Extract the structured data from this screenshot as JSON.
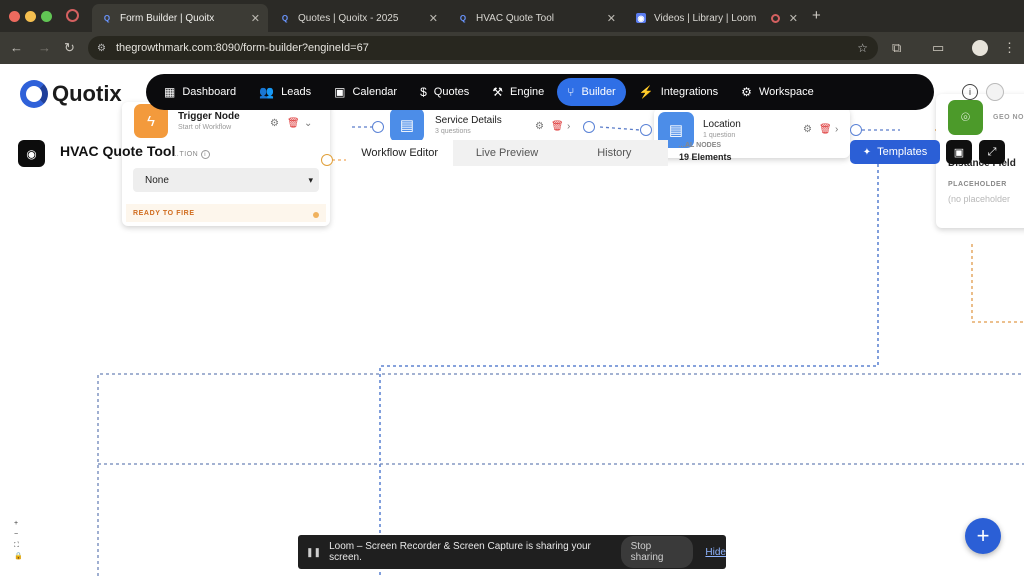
{
  "browser": {
    "tabs": [
      {
        "title": "Form Builder | Quoitx",
        "active": true,
        "favicon": "quotix-icon"
      },
      {
        "title": "Quotes | Quoitx - 2025",
        "active": false,
        "favicon": "quotix-icon"
      },
      {
        "title": "HVAC Quote Tool",
        "active": false,
        "favicon": "quotix-icon"
      },
      {
        "title": "Videos | Library | Loom",
        "active": false,
        "favicon": "loom-icon"
      }
    ],
    "url": "thegrowthmark.com:8090/form-builder?engineId=67"
  },
  "app": {
    "logo_text": "Quotix",
    "nav": [
      {
        "label": "Dashboard",
        "icon": "grid-icon",
        "active": false
      },
      {
        "label": "Leads",
        "icon": "users-icon",
        "active": false
      },
      {
        "label": "Calendar",
        "icon": "calendar-icon",
        "active": false
      },
      {
        "label": "Quotes",
        "icon": "dollar-icon",
        "active": false
      },
      {
        "label": "Engine",
        "icon": "engine-icon",
        "active": false
      },
      {
        "label": "Builder",
        "icon": "builder-icon",
        "active": true
      },
      {
        "label": "Integrations",
        "icon": "plug-icon",
        "active": false
      },
      {
        "label": "Workspace",
        "icon": "gear-icon",
        "active": false
      }
    ],
    "tool_title": "HVAC Quote Tool",
    "editor_tabs": [
      {
        "label": "Workflow Editor",
        "active": true
      },
      {
        "label": "Live Preview",
        "active": false
      },
      {
        "label": "History",
        "active": false
      }
    ],
    "templates_label": "Templates",
    "nodes": {
      "trigger": {
        "title": "Trigger Node",
        "subtitle": "Start of Workflow",
        "field_label": "…TION",
        "select_value": "None",
        "status": "READY TO FIRE"
      },
      "service": {
        "title": "Service Details",
        "subtitle": "3 questions"
      },
      "location": {
        "title": "Location",
        "subtitle": "1 question",
        "stats_label": "…AL NODES",
        "stats_value": "19 Elements"
      },
      "geo": {
        "header": "GEO NO",
        "field_title": "Distance Field",
        "placeholder_label": "PLACEHOLDER",
        "placeholder_value": "(no placeholder"
      }
    },
    "zoom_controls": [
      "+",
      "−",
      "⛶",
      "🔒"
    ],
    "colors": {
      "accent": "#2f6fe6",
      "trigger": "#f39a3c",
      "doc": "#4c8de8",
      "geo": "#4c9a2a"
    }
  },
  "loom": {
    "message": "Loom – Screen Recorder & Screen Capture is sharing your screen.",
    "stop_label": "Stop sharing",
    "hide_label": "Hide"
  }
}
